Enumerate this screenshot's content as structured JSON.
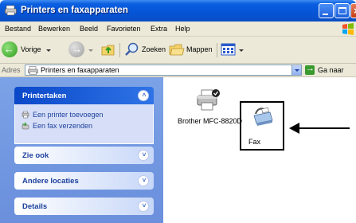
{
  "window": {
    "title": "Printers en faxapparaten"
  },
  "menu": [
    "Bestand",
    "Bewerken",
    "Beeld",
    "Favorieten",
    "Extra",
    "Help"
  ],
  "toolbar": {
    "back_label": "Vorige",
    "search_label": "Zoeken",
    "folders_label": "Mappen"
  },
  "address": {
    "label": "Adres",
    "value": "Printers en faxapparaten",
    "go_label": "Ga naar"
  },
  "sidebar": {
    "panels": [
      {
        "title": "Printertaken",
        "expanded": true,
        "tasks": [
          "Een printer toevoegen",
          "Een fax verzenden"
        ]
      },
      {
        "title": "Zie ook",
        "expanded": false
      },
      {
        "title": "Andere locaties",
        "expanded": false
      },
      {
        "title": "Details",
        "expanded": false
      }
    ]
  },
  "items": [
    {
      "label": "Brother MFC-8820D",
      "icon": "printer-default-icon"
    },
    {
      "label": "Fax",
      "icon": "fax-icon",
      "highlighted": true
    }
  ],
  "colors": {
    "titlebar": "#0554d6",
    "sidebar": "#7ba2e7",
    "panel_head": "#0a48c9"
  }
}
